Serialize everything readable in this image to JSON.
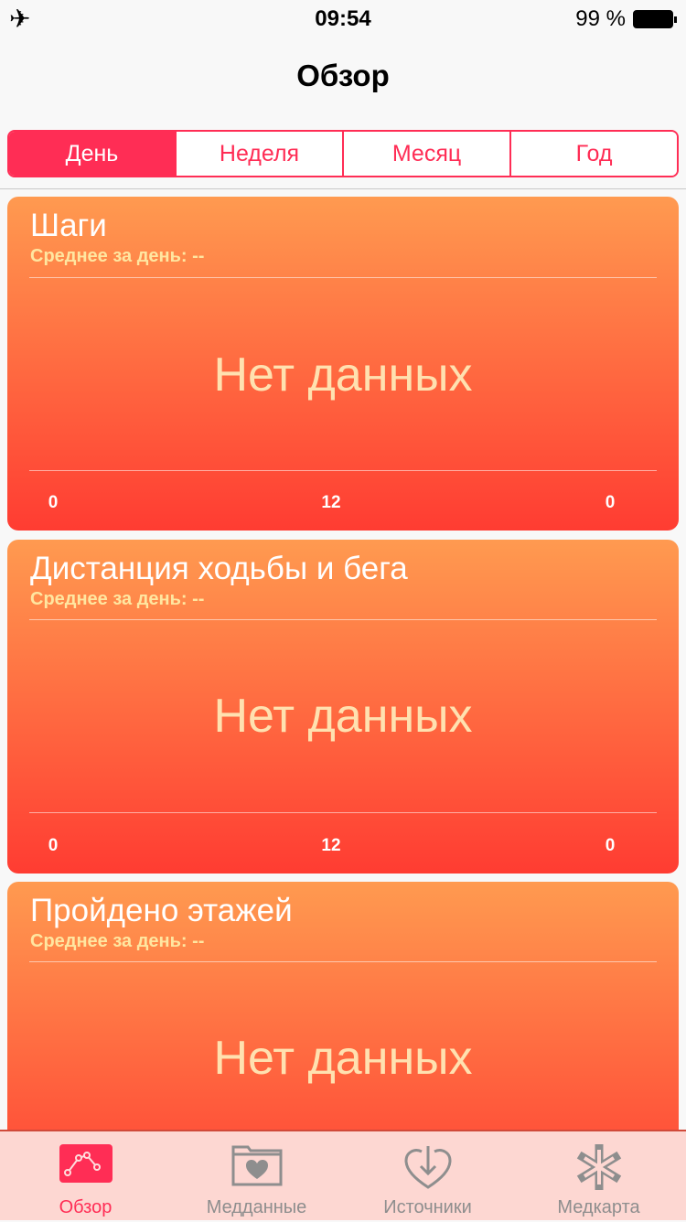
{
  "status": {
    "time": "09:54",
    "battery": "99 %"
  },
  "header": {
    "title": "Обзор"
  },
  "segments": [
    "День",
    "Неделя",
    "Месяц",
    "Год"
  ],
  "cards": [
    {
      "title": "Шаги",
      "subtitle": "Среднее за день: --",
      "empty": "Нет данных",
      "axis": [
        "0",
        "12",
        "0"
      ]
    },
    {
      "title": "Дистанция ходьбы и бега",
      "subtitle": "Среднее за день: --",
      "empty": "Нет данных",
      "axis": [
        "0",
        "12",
        "0"
      ]
    },
    {
      "title": "Пройдено этажей",
      "subtitle": "Среднее за день: --",
      "empty": "Нет данных"
    }
  ],
  "tabs": [
    {
      "label": "Обзор",
      "icon": "chart-icon"
    },
    {
      "label": "Медданные",
      "icon": "health-folder-icon"
    },
    {
      "label": "Источники",
      "icon": "heart-download-icon"
    },
    {
      "label": "Медкарта",
      "icon": "medical-star-icon"
    }
  ],
  "colors": {
    "accent": "#ff2d55",
    "card_top": "#ff9a50",
    "card_bottom": "#ff3c32"
  }
}
